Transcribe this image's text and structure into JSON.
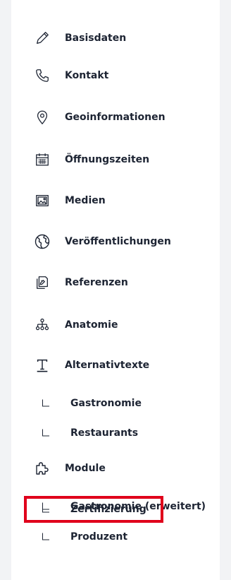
{
  "nav": {
    "items": [
      {
        "label": "Basisdaten",
        "icon": "pencil-icon"
      },
      {
        "label": "Kontakt",
        "icon": "phone-icon"
      },
      {
        "label": "Geoinformationen",
        "icon": "map-pin-icon"
      },
      {
        "label": "Öffnungszeiten",
        "icon": "calendar-icon"
      },
      {
        "label": "Medien",
        "icon": "image-icon"
      },
      {
        "label": "Veröffentlichungen",
        "icon": "globe-icon"
      },
      {
        "label": "Referenzen",
        "icon": "documents-icon"
      },
      {
        "label": "Anatomie",
        "icon": "hierarchy-icon"
      },
      {
        "label": "Alternativtexte",
        "icon": "text-icon"
      },
      {
        "label": "Gastronomie",
        "sub": true
      },
      {
        "label": "Restaurants",
        "sub": true
      },
      {
        "label": "Module",
        "icon": "puzzle-icon"
      },
      {
        "label": "Gastronomie (erweitert)",
        "sub": true
      },
      {
        "label": "Produzent",
        "sub": true
      },
      {
        "label": "Zertifizierung",
        "sub": true,
        "highlighted": true
      }
    ]
  },
  "colors": {
    "background": "#f2f3f5",
    "panel": "#ffffff",
    "text": "#1d2433",
    "highlight": "#e0001b"
  }
}
